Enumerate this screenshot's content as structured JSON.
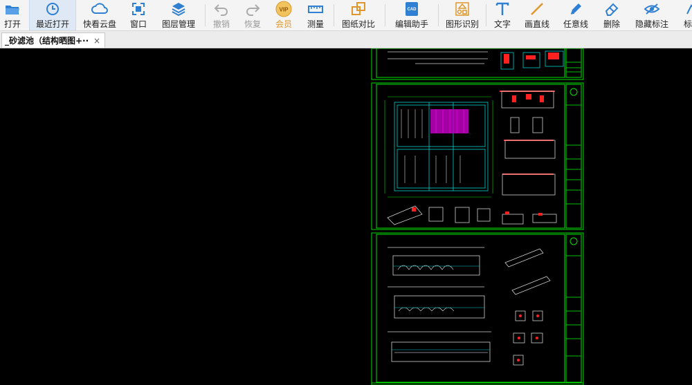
{
  "toolbar": {
    "items": [
      {
        "label": "打开",
        "icon": "folder-icon"
      },
      {
        "label": "最近打开",
        "icon": "clock-icon"
      },
      {
        "label": "快看云盘",
        "icon": "cloud-icon"
      },
      {
        "label": "窗口",
        "icon": "window-icon"
      },
      {
        "label": "图层管理",
        "icon": "layers-icon"
      },
      {
        "label": "撤销",
        "icon": "undo-icon"
      },
      {
        "label": "恢复",
        "icon": "redo-icon"
      },
      {
        "label": "会员",
        "icon": "vip-icon",
        "badge": "VIP"
      },
      {
        "label": "测量",
        "icon": "ruler-icon"
      },
      {
        "label": "图纸对比",
        "icon": "compare-icon"
      },
      {
        "label": "编辑助手",
        "icon": "edit-helper-icon",
        "badge": "CAD"
      },
      {
        "label": "图形识别",
        "icon": "shape-recognize-icon"
      },
      {
        "label": "文字",
        "icon": "text-icon"
      },
      {
        "label": "画直线",
        "icon": "line-icon"
      },
      {
        "label": "任意线",
        "icon": "pen-icon"
      },
      {
        "label": "删除",
        "icon": "eraser-icon"
      },
      {
        "label": "隐藏标注",
        "icon": "eye-icon"
      },
      {
        "label": "标注",
        "icon": "annotate-icon"
      }
    ]
  },
  "tab": {
    "title": "_砂滤池（结构晒图+··",
    "close": "×"
  },
  "colors": {
    "accent": "#3d86d6",
    "vip": "#e0962a",
    "drawing_frame": "#00e000",
    "canvas": "#000000"
  }
}
